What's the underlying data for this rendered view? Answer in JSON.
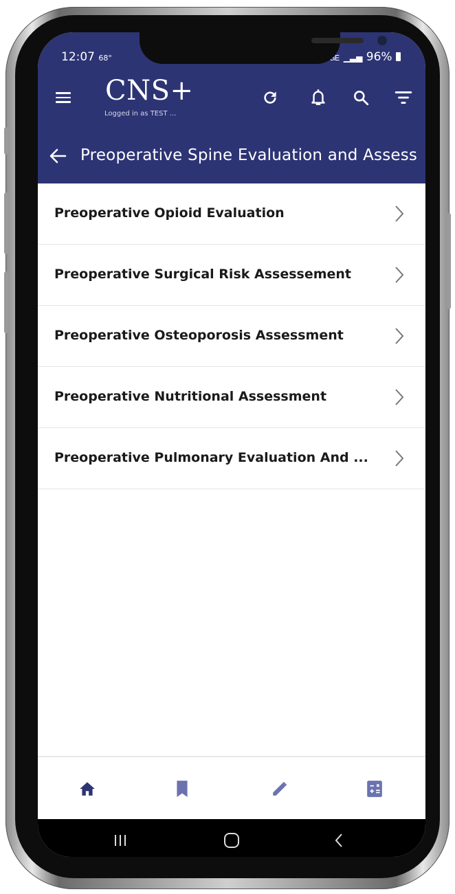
{
  "status_bar": {
    "time": "12:07",
    "temperature": "68°",
    "network": "ᏞᏀᎬ",
    "battery": "96%"
  },
  "app_bar": {
    "title": "CNS+",
    "subtitle": "Logged in as TEST ...",
    "icons": [
      "menu-icon",
      "refresh-icon",
      "bell-icon",
      "search-icon",
      "filter-icon"
    ]
  },
  "subheader": {
    "title": "Preoperative Spine Evaluation and Assess"
  },
  "list": {
    "items": [
      {
        "label": "Preoperative Opioid Evaluation"
      },
      {
        "label": "Preoperative Surgical Risk Assessement"
      },
      {
        "label": "Preoperative Osteoporosis Assessment"
      },
      {
        "label": "Preoperative Nutritional Assessment"
      },
      {
        "label": "Preoperative Pulmonary Evaluation And ..."
      }
    ]
  },
  "bottom_nav": {
    "items": [
      "home-icon",
      "bookmark-icon",
      "pencil-icon",
      "calculator-icon"
    ],
    "active_color": "#2d3474",
    "inactive_color": "#6b72b0"
  },
  "colors": {
    "primary": "#2d3474",
    "background": "#ffffff",
    "text": "#1a1a1a",
    "divider": "#e6e6e6"
  }
}
